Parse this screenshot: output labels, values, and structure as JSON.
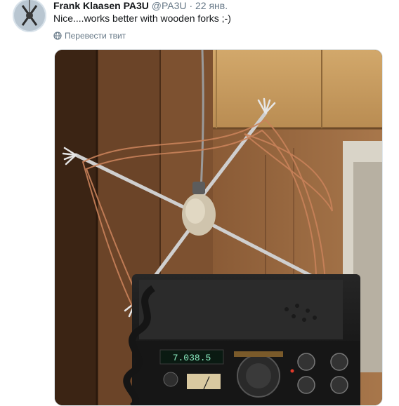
{
  "tweet": {
    "author_name": "Frank Klaasen PA3U",
    "author_handle": "@PA3U",
    "separator": "·",
    "timestamp": "22 янв.",
    "text": "Nice....works better with wooden forks ;-)",
    "translate_label": "Перевести твит",
    "translate_icon": "globe-icon"
  },
  "photo": {
    "radio_frequency_display": "7.038.5",
    "subject": "fork-antenna-photo"
  },
  "colors": {
    "text_primary": "#14171a",
    "text_secondary": "#657786",
    "border": "#e1e8ed"
  }
}
